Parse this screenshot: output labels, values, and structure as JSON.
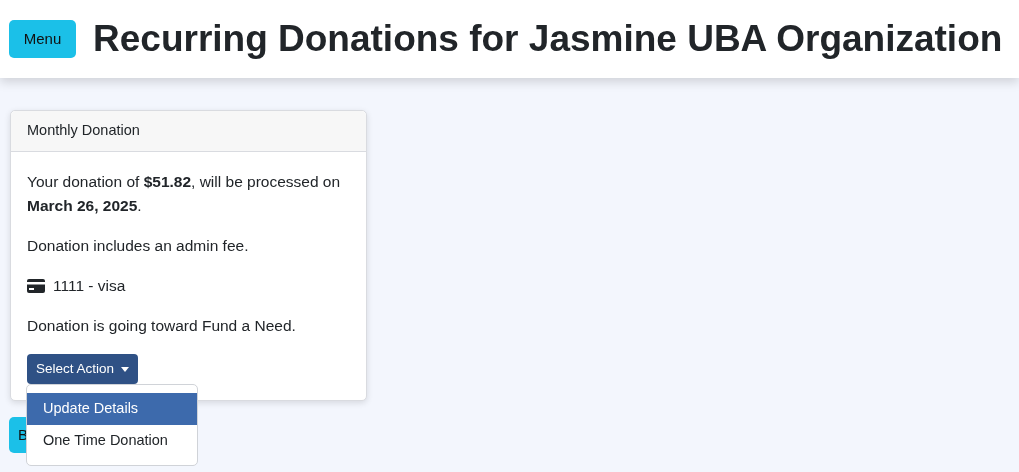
{
  "header": {
    "menu_button": "Menu",
    "title": "Recurring Donations for Jasmine UBA Organization"
  },
  "card": {
    "title": "Monthly Donation",
    "summary": "Your donation of **$51.82**, will be processed on **March 26, 2025**.",
    "fee_note": "Donation includes an admin fee.",
    "payment_method": "1111 - visa",
    "fund_note": "Donation is going toward Fund a Need.",
    "action_button": "Select Action",
    "menu_items": [
      {
        "label": "Update Details",
        "selected": true
      },
      {
        "label": "One Time Donation",
        "selected": false
      }
    ]
  },
  "bottom_button": "B"
}
